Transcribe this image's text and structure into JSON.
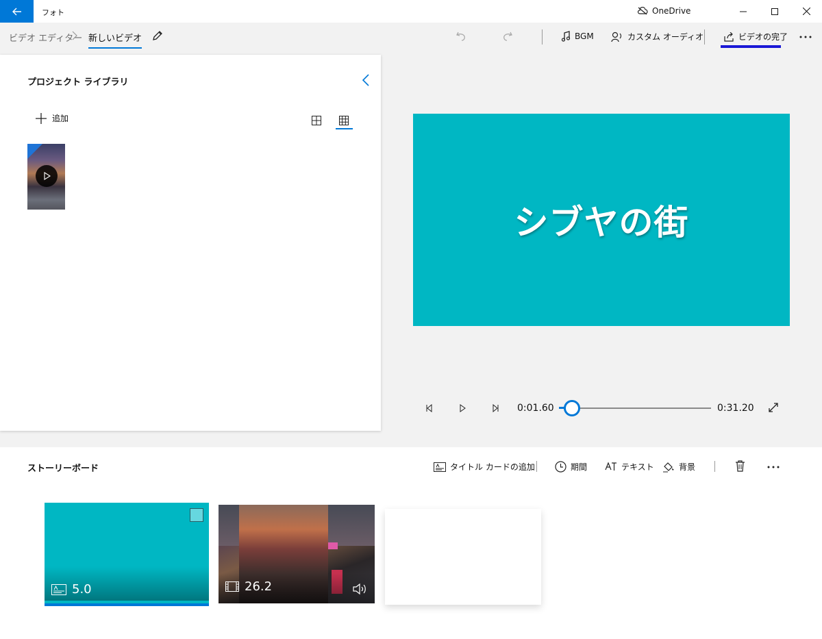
{
  "titlebar": {
    "app_title": "フォト",
    "onedrive_label": "OneDrive"
  },
  "breadcrumb": {
    "root": "ビデオ エディター",
    "current": "新しいビデオ"
  },
  "toolbar": {
    "bgm_label": "BGM",
    "custom_audio_label": "カスタム オーディオ",
    "finish_label": "ビデオの完了"
  },
  "library": {
    "title": "プロジェクト ライブラリ",
    "add_label": "追加"
  },
  "preview": {
    "title_text": "シブヤの街"
  },
  "playback": {
    "current_time": "0:01.60",
    "total_time": "0:31.20",
    "progress_fraction": 0.05
  },
  "storyboard": {
    "title": "ストーリーボード",
    "add_title_card_label": "タイトル カードの追加",
    "duration_label": "期間",
    "text_label": "テキスト",
    "background_label": "背景",
    "cards": [
      {
        "duration": "5.0"
      },
      {
        "duration": "26.2"
      }
    ]
  },
  "colors": {
    "accent": "#0078d7",
    "title_card": "#00b7c3",
    "finish_underline": "#1a18d6"
  }
}
